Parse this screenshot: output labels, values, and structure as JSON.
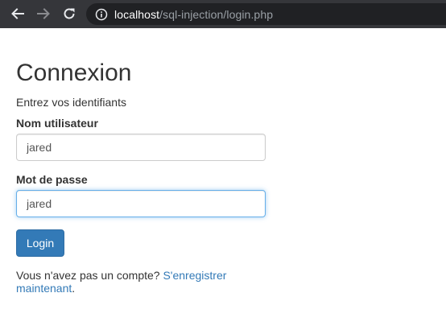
{
  "browser": {
    "url_host": "localhost",
    "url_path": "/sql-injection/login.php",
    "back_icon": "arrow-left-icon",
    "forward_icon": "arrow-right-icon",
    "reload_icon": "reload-icon",
    "site_info_icon": "info-icon"
  },
  "page": {
    "title": "Connexion",
    "subtitle": "Entrez vos identifiants"
  },
  "form": {
    "username_label": "Nom utilisateur",
    "username_value": "jared",
    "password_label": "Mot de passe",
    "password_value": "jared",
    "submit_label": "Login"
  },
  "register": {
    "prompt": "Vous n'avez pas un compte?",
    "link_text": "S'enregistrer maintenant",
    "end": "."
  },
  "colors": {
    "toolbar_bg": "#35363a",
    "omnibox_bg": "#202124",
    "primary": "#337ab7",
    "focus_border": "#66afe9",
    "text": "#333333"
  }
}
